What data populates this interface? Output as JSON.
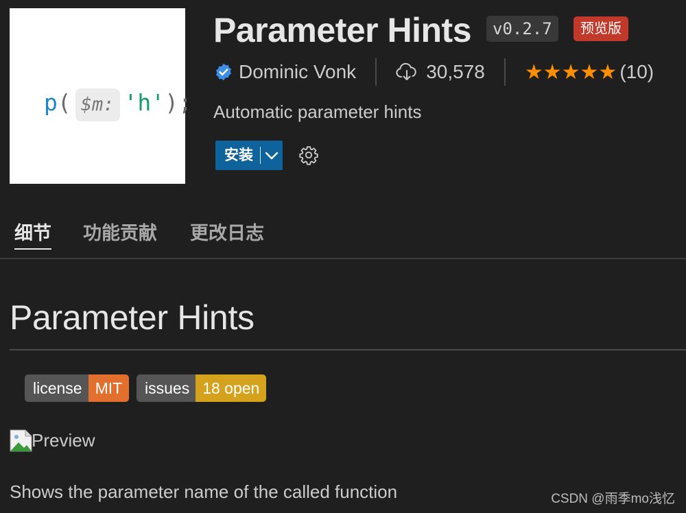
{
  "extension": {
    "icon_code": {
      "fn": "p",
      "open_paren": "(",
      "hint": "$m:",
      "string": "'h'",
      "close": ");"
    },
    "title": "Parameter Hints",
    "version": "v0.2.7",
    "preview_badge": "预览版",
    "publisher": "Dominic Vonk",
    "installs": "30,578",
    "stars": "★★★★★",
    "rating_count": "(10)",
    "description": "Automatic parameter hints",
    "install_label": "安装"
  },
  "tabs": [
    {
      "label": "细节",
      "active": true
    },
    {
      "label": "功能贡献",
      "active": false
    },
    {
      "label": "更改日志",
      "active": false
    }
  ],
  "readme": {
    "title": "Parameter Hints",
    "badges": [
      {
        "label": "license",
        "value": "MIT",
        "color": "#e36f2e"
      },
      {
        "label": "issues",
        "value": "18 open",
        "color": "#d5a21d"
      }
    ],
    "image_alt": "Preview",
    "text": "Shows the parameter name of the called function"
  },
  "watermark": "CSDN @雨季mo浅忆",
  "colors": {
    "background": "#1f1f1f",
    "accent_blue": "#0e639c",
    "verified_blue": "#3d8ee8",
    "star_orange": "#ff8e00",
    "preview_red": "#c0392b"
  },
  "icons": [
    "verified-icon",
    "cloud-download-icon",
    "chevron-down-icon",
    "gear-icon",
    "image-placeholder-icon"
  ]
}
